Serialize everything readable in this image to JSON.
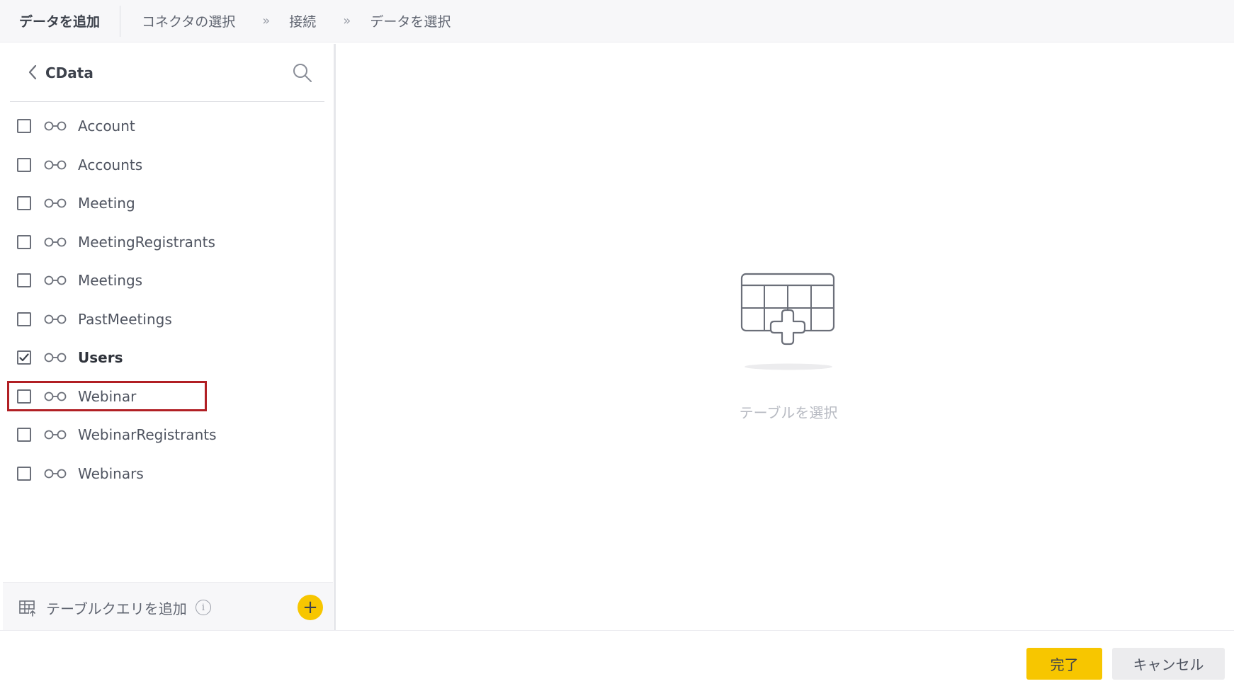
{
  "header": {
    "title": "データを追加",
    "breadcrumbs": [
      "コネクタの選択",
      "接続",
      "データを選択"
    ],
    "separator": "»"
  },
  "sidebar": {
    "title": "CData",
    "items": [
      {
        "label": "Account",
        "checked": false
      },
      {
        "label": "Accounts",
        "checked": false
      },
      {
        "label": "Meeting",
        "checked": false
      },
      {
        "label": "MeetingRegistrants",
        "checked": false
      },
      {
        "label": "Meetings",
        "checked": false
      },
      {
        "label": "PastMeetings",
        "checked": false
      },
      {
        "label": "Users",
        "checked": true
      },
      {
        "label": "Webinar",
        "checked": false
      },
      {
        "label": "WebinarRegistrants",
        "checked": false
      },
      {
        "label": "Webinars",
        "checked": false
      }
    ],
    "footer": {
      "label": "テーブルクエリを追加",
      "info": "i",
      "add": "+"
    }
  },
  "main": {
    "empty_text": "テーブルを選択"
  },
  "actions": {
    "done_label": "完了",
    "cancel_label": "キャンセル"
  },
  "colors": {
    "accent": "#f7c600",
    "highlight": "#b11f24",
    "header_bg": "#f7f7f9"
  }
}
